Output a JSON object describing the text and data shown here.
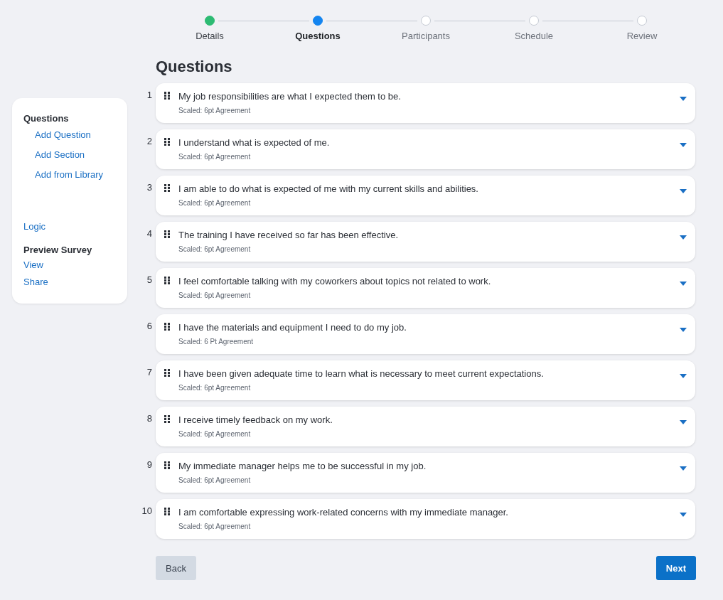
{
  "steps": [
    {
      "label": "Details",
      "completed": true,
      "selected": false
    },
    {
      "label": "Questions",
      "completed": false,
      "selected": true
    },
    {
      "label": "Participants",
      "completed": false,
      "selected": false
    },
    {
      "label": "Schedule",
      "completed": false,
      "selected": false
    },
    {
      "label": "Review",
      "completed": false,
      "selected": false
    }
  ],
  "heading": "Questions",
  "sidebar": {
    "items": [
      {
        "label": "Questions",
        "kind": "heading",
        "children": [
          {
            "label": "Add Question",
            "kind": "link"
          },
          {
            "label": "Add Section",
            "kind": "link"
          },
          {
            "label": "Add from Library",
            "kind": "link"
          }
        ]
      },
      {
        "label": "Logic",
        "kind": "link"
      },
      {
        "label": "Preview Survey",
        "kind": "heading"
      },
      {
        "label": "View",
        "kind": "link"
      },
      {
        "label": "Share",
        "kind": "link"
      }
    ]
  },
  "questions": [
    {
      "number": "1",
      "text": "My job responsibilities are what I expected them to be.",
      "scale": "Scaled: 6pt Agreement"
    },
    {
      "number": "2",
      "text": "I understand what is expected of me.",
      "scale": "Scaled: 6pt Agreement"
    },
    {
      "number": "3",
      "text": "I am able to do what is expected of me with my current skills and abilities.",
      "scale": "Scaled: 6pt Agreement"
    },
    {
      "number": "4",
      "text": "The training I have received so far has been effective.",
      "scale": "Scaled: 6pt Agreement"
    },
    {
      "number": "5",
      "text": "I feel comfortable talking with my coworkers about topics not related to work.",
      "scale": "Scaled: 6pt Agreement"
    },
    {
      "number": "6",
      "text": "I have the materials and equipment I need to do my job.",
      "scale": "Scaled: 6 Pt Agreement"
    },
    {
      "number": "7",
      "text": "I have been given adequate time to learn what is necessary to meet current expectations.",
      "scale": "Scaled: 6pt Agreement"
    },
    {
      "number": "8",
      "text": "I receive timely feedback on my work.",
      "scale": "Scaled: 6pt Agreement"
    },
    {
      "number": "9",
      "text": "My immediate manager helps me to be successful in my job.",
      "scale": "Scaled: 6pt Agreement"
    },
    {
      "number": "10",
      "text": "I am comfortable expressing work-related concerns with my immediate manager.",
      "scale": "Scaled: 6pt Agreement"
    }
  ],
  "buttons": {
    "back": "Back",
    "next": "Next"
  }
}
